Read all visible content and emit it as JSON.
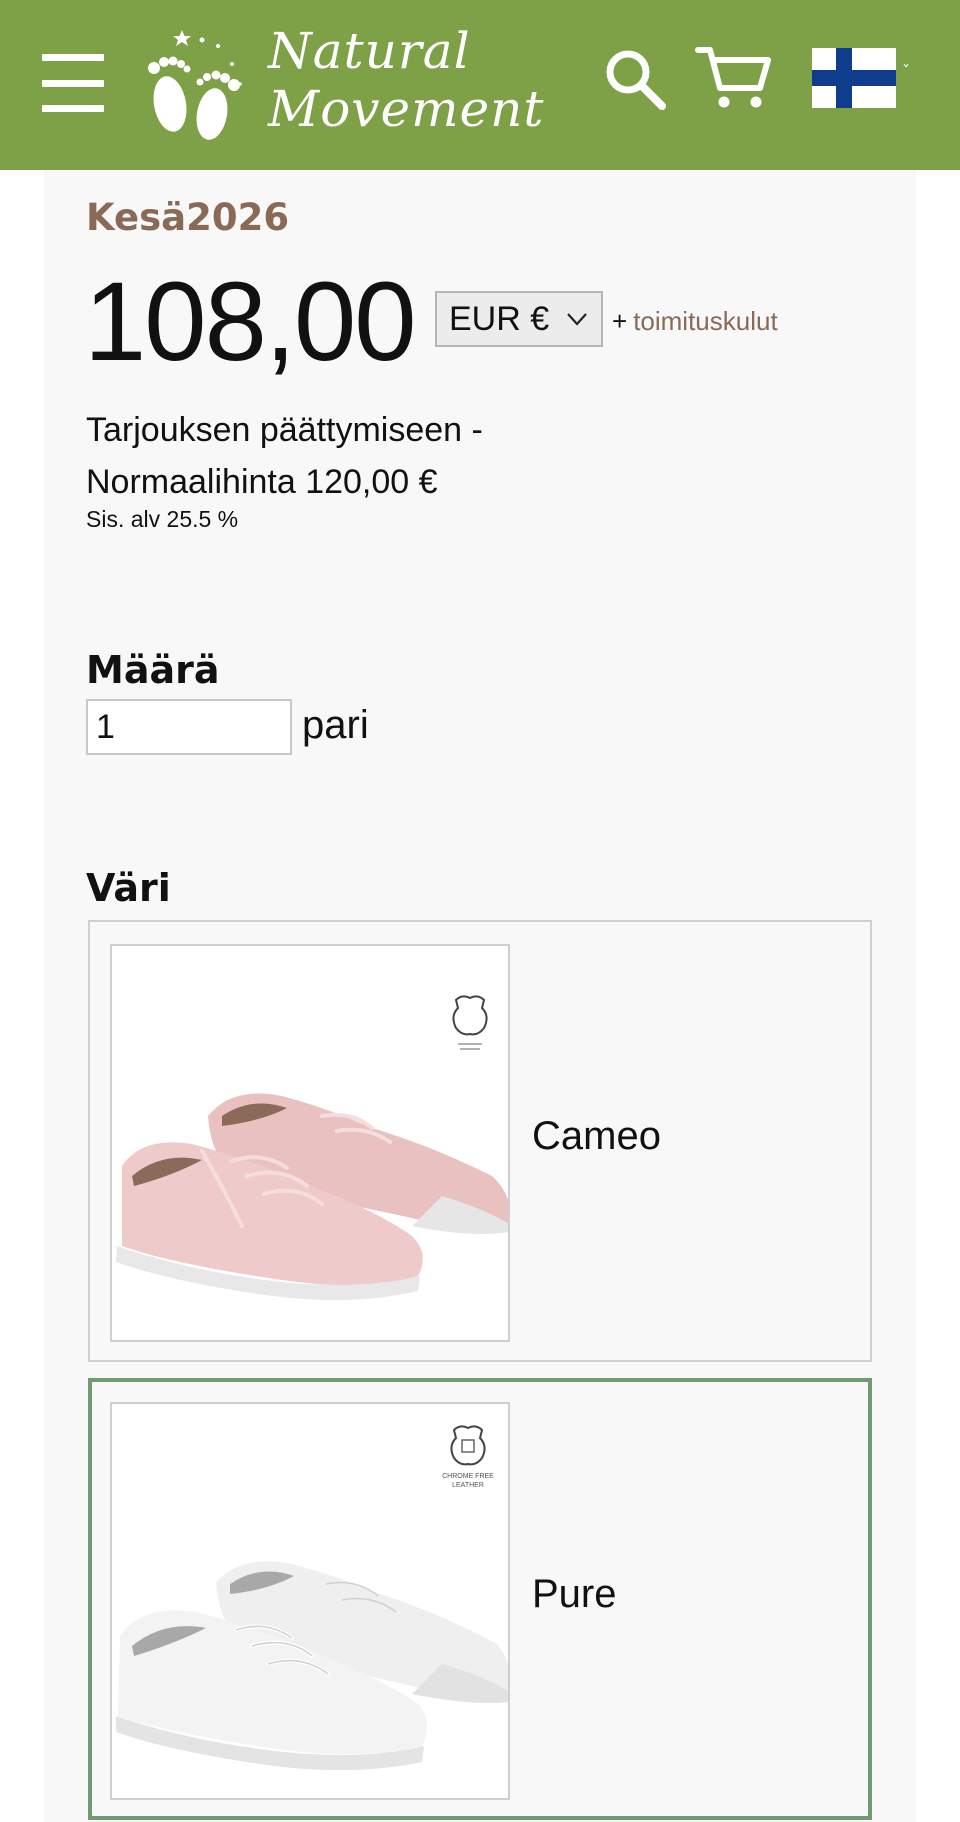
{
  "header": {
    "brand_line1": "Natural",
    "brand_line2": "Movement",
    "menu_icon": "hamburger-menu-icon",
    "search_icon": "search-icon",
    "cart_icon": "shopping-cart-icon",
    "language_flag": "finland-flag-icon",
    "language_caret": "ˇ",
    "header_color": "#7ea046"
  },
  "product": {
    "campaign": "Kesä2026",
    "price": "108,00",
    "currency": "EUR €",
    "shipping_prefix": "+",
    "shipping_link": "toimituskulut",
    "offer_text": "Tarjouksen päättymiseen -",
    "normal_price_text": "Normaalihinta 120,00 €",
    "vat_text": "Sis. alv 25.5 %",
    "accent_color": "#8a6a56"
  },
  "quantity": {
    "label": "Määrä",
    "value": "1",
    "unit": "pari"
  },
  "color": {
    "label": "Väri",
    "options": [
      {
        "name": "Cameo",
        "image": "pink-leather-sneakers",
        "badge": "leather-badge-icon",
        "selected": false
      },
      {
        "name": "Pure",
        "image": "white-leather-sneakers",
        "badge": "chrome-free-leather-badge-icon",
        "badge_text_1": "CHROME FREE",
        "badge_text_2": "LEATHER",
        "selected": true
      }
    ],
    "selected_border_color": "#6f9a73"
  }
}
